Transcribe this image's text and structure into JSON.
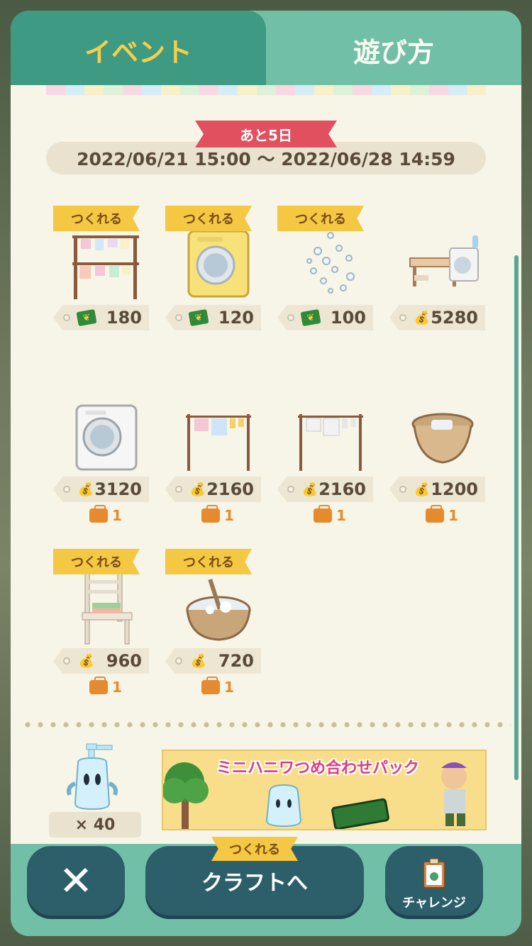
{
  "tabs": {
    "event": "イベント",
    "howto": "遊び方"
  },
  "period": {
    "remaining": "あと5日",
    "range": "2022/06/21 15:00 ～ 2022/06/28 14:59"
  },
  "craftable_label": "つくれる",
  "items": [
    {
      "name": "clothesline-stand",
      "craftable": true,
      "currency": "leaf-ticket",
      "price": "180",
      "count": ""
    },
    {
      "name": "yellow-washing-machine",
      "craftable": true,
      "currency": "leaf-ticket",
      "price": "120",
      "count": ""
    },
    {
      "name": "bubbles",
      "craftable": true,
      "currency": "leaf-ticket",
      "price": "100",
      "count": ""
    },
    {
      "name": "laundry-desk-set",
      "craftable": false,
      "currency": "bells",
      "price": "5280",
      "count": ""
    },
    {
      "name": "white-washing-machine",
      "craftable": false,
      "currency": "bells",
      "price": "3120",
      "count": "1"
    },
    {
      "name": "hanging-laundry-a",
      "craftable": false,
      "currency": "bells",
      "price": "2160",
      "count": "1"
    },
    {
      "name": "hanging-laundry-b",
      "craftable": false,
      "currency": "bells",
      "price": "2160",
      "count": "1"
    },
    {
      "name": "laundry-basket",
      "craftable": false,
      "currency": "bells",
      "price": "1200",
      "count": "1"
    },
    {
      "name": "chair-with-towels",
      "craftable": true,
      "currency": "bells",
      "price": "960",
      "count": "1"
    },
    {
      "name": "washtub",
      "craftable": true,
      "currency": "bells",
      "price": "720",
      "count": "1"
    }
  ],
  "spray": {
    "count": "× 40"
  },
  "banner": {
    "title": "ミニハニワつめ合わせパック"
  },
  "buttons": {
    "craft": "クラフトへ",
    "craft_tag": "つくれる",
    "challenge": "チャレンジ",
    "close": "✕"
  },
  "colors": {
    "tab_active": "#3e9a82",
    "tag": "#f4c843",
    "badge": "#e1505f",
    "button": "#2d5f6b"
  }
}
